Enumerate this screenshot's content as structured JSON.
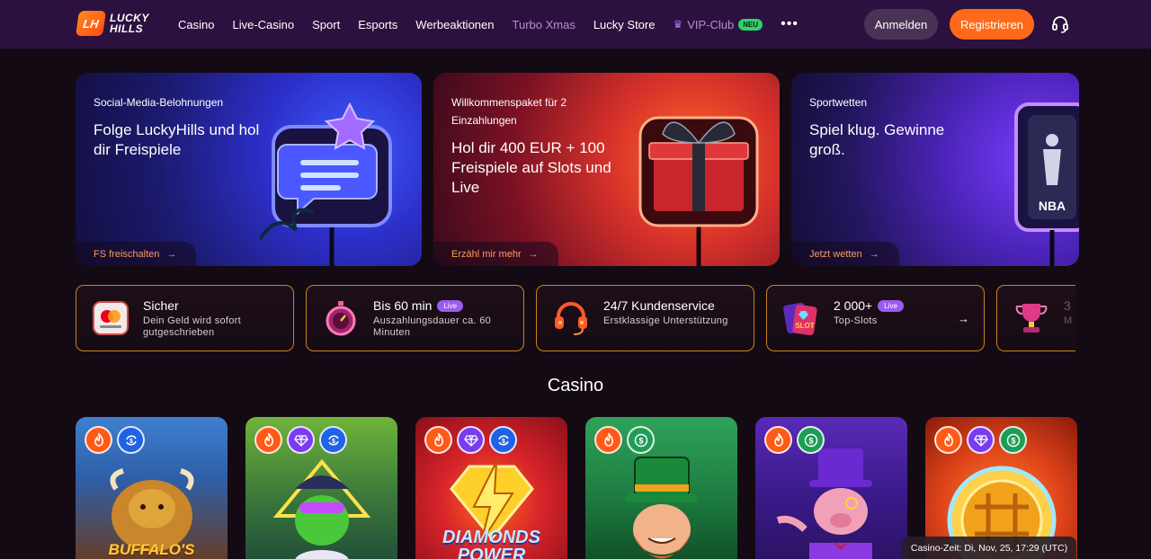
{
  "brand": {
    "mark": "LH",
    "line1": "LUCKY",
    "line2": "HILLS"
  },
  "nav": {
    "items": [
      "Casino",
      "Live-Casino",
      "Sport",
      "Esports",
      "Werbeaktionen",
      "Turbo Xmas",
      "Lucky Store"
    ],
    "vip_label": "VIP-Club",
    "vip_badge": "NEU",
    "more": "•••"
  },
  "header": {
    "login": "Anmelden",
    "register": "Registrieren"
  },
  "banners": [
    {
      "subtitle": "Social-Media-Belohnungen",
      "title": "Folge LuckyHills und hol dir Freispiele",
      "cta": "FS freischalten"
    },
    {
      "subtitle": "Willkommenspaket für 2 Einzahlungen",
      "title": "Hol dir 400 EUR + 100 Freispiele auf Slots und Live",
      "cta": "Erzähl mir mehr"
    },
    {
      "subtitle": "Sportwetten",
      "title": "Spiel klug. Gewinne groß.",
      "cta": "Jetzt wetten"
    }
  ],
  "features": [
    {
      "title": "Sicher",
      "desc": "Dein Geld wird sofort gutgeschrieben",
      "icon": "mastercard-icon"
    },
    {
      "title": "Bis 60 min",
      "badge": "Live",
      "desc": "Auszahlungsdauer ca. 60 Minuten",
      "icon": "stopwatch-icon"
    },
    {
      "title": "24/7 Kundenservice",
      "desc": "Erstklassige Unterstützung",
      "icon": "headset-icon"
    },
    {
      "title": "2 000+",
      "badge": "Live",
      "desc": "Top-Slots",
      "icon": "slot-cards-icon"
    },
    {
      "title": "3",
      "desc": "M",
      "icon": "trophy-icon"
    }
  ],
  "casino": {
    "title": "Casino",
    "games": [
      {
        "name": "BUFFALO'S",
        "badges": [
          "fire",
          "refresh"
        ]
      },
      {
        "name": "",
        "badges": [
          "fire",
          "vip",
          "refresh"
        ]
      },
      {
        "name": "DIAMONDS POWER",
        "badges": [
          "fire",
          "vip",
          "refresh"
        ]
      },
      {
        "name": "",
        "badges": [
          "fire",
          "cash"
        ]
      },
      {
        "name": "",
        "badges": [
          "fire",
          "cash"
        ]
      },
      {
        "name": "",
        "badges": [
          "fire",
          "vip",
          "cash"
        ]
      }
    ]
  },
  "casino_time": "Casino-Zeit: Di, Nov, 25, 17:29 (UTC)",
  "colors": {
    "header_bg": "#2c1140",
    "accent": "#ff6a1a",
    "feature_border": "#c9841f",
    "page_bg": "#140a14"
  }
}
